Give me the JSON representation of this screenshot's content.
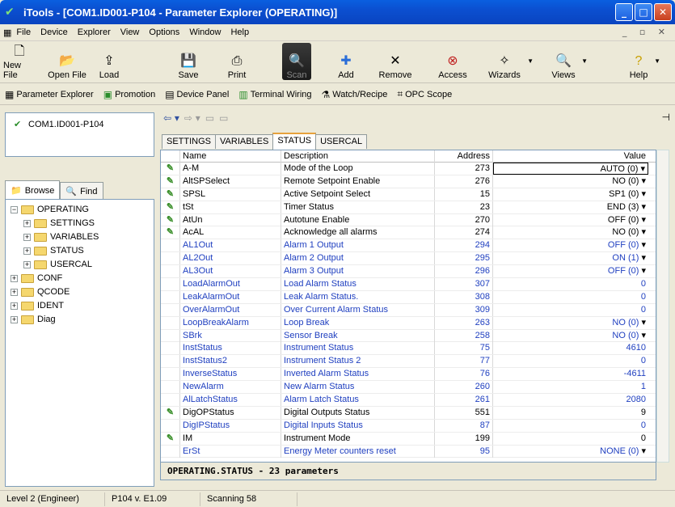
{
  "window": {
    "title": "iTools - [COM1.ID001-P104 - Parameter Explorer (OPERATING)]"
  },
  "menu": [
    "File",
    "Device",
    "Explorer",
    "View",
    "Options",
    "Window",
    "Help"
  ],
  "toolbar": [
    {
      "label": "New File",
      "icon": "new-file-icon"
    },
    {
      "label": "Open File",
      "icon": "open-file-icon"
    },
    {
      "label": "Load",
      "icon": "load-icon"
    },
    {
      "label": "Save",
      "icon": "save-icon"
    },
    {
      "label": "Print",
      "icon": "print-icon"
    },
    {
      "label": "Scan",
      "icon": "scan-icon"
    },
    {
      "label": "Add",
      "icon": "add-icon"
    },
    {
      "label": "Remove",
      "icon": "remove-icon"
    },
    {
      "label": "Access",
      "icon": "access-icon"
    },
    {
      "label": "Wizards",
      "icon": "wizards-icon"
    },
    {
      "label": "Views",
      "icon": "views-icon"
    },
    {
      "label": "Help",
      "icon": "help-icon"
    }
  ],
  "toolbar2": [
    "Parameter Explorer",
    "Promotion",
    "Device Panel",
    "Terminal Wiring",
    "Watch/Recipe",
    "OPC Scope"
  ],
  "device": "COM1.ID001-P104",
  "left_tabs": [
    "Browse",
    "Find"
  ],
  "tree": {
    "root": "OPERATING",
    "children": [
      "SETTINGS",
      "VARIABLES",
      "STATUS",
      "USERCAL"
    ],
    "others": [
      "CONF",
      "QCODE",
      "IDENT",
      "Diag"
    ]
  },
  "param_tabs": [
    "SETTINGS",
    "VARIABLES",
    "STATUS",
    "USERCAL"
  ],
  "grid": {
    "headers": [
      "Name",
      "Description",
      "Address",
      "Value"
    ],
    "rows": [
      {
        "name": "A-M",
        "desc": "Mode of the Loop",
        "addr": "273",
        "value": "AUTO (0)",
        "dd": true
      },
      {
        "name": "AltSPSelect",
        "desc": "Remote Setpoint Enable",
        "addr": "276",
        "value": "NO (0)",
        "dd": true
      },
      {
        "name": "SPSL",
        "desc": "Active Setpoint Select",
        "addr": "15",
        "value": "SP1 (0)",
        "dd": true
      },
      {
        "name": "tSt",
        "desc": "Timer Status",
        "addr": "23",
        "value": "END (3)",
        "dd": true
      },
      {
        "name": "AtUn",
        "desc": "Autotune Enable",
        "addr": "270",
        "value": "OFF (0)",
        "dd": true
      },
      {
        "name": "AcAL",
        "desc": "Acknowledge all alarms",
        "addr": "274",
        "value": "NO (0)",
        "dd": true
      },
      {
        "name": "AL1Out",
        "desc": "Alarm 1 Output",
        "addr": "294",
        "value": "OFF (0)",
        "dd": true
      },
      {
        "name": "AL2Out",
        "desc": "Alarm 2 Output",
        "addr": "295",
        "value": "ON (1)",
        "dd": true
      },
      {
        "name": "AL3Out",
        "desc": "Alarm 3 Output",
        "addr": "296",
        "value": "OFF (0)",
        "dd": true
      },
      {
        "name": "LoadAlarmOut",
        "desc": "Load Alarm Status",
        "addr": "307",
        "value": "0",
        "dd": false
      },
      {
        "name": "LeakAlarmOut",
        "desc": "Leak Alarm Status.",
        "addr": "308",
        "value": "0",
        "dd": false
      },
      {
        "name": "OverAlarmOut",
        "desc": "Over Current Alarm Status",
        "addr": "309",
        "value": "0",
        "dd": false
      },
      {
        "name": "LoopBreakAlarm",
        "desc": "Loop Break",
        "addr": "263",
        "value": "NO (0)",
        "dd": true
      },
      {
        "name": "SBrk",
        "desc": "Sensor Break",
        "addr": "258",
        "value": "NO (0)",
        "dd": true
      },
      {
        "name": "InstStatus",
        "desc": "Instrument Status",
        "addr": "75",
        "value": "4610",
        "dd": false
      },
      {
        "name": "InstStatus2",
        "desc": "Instrument Status 2",
        "addr": "77",
        "value": "0",
        "dd": false
      },
      {
        "name": "InverseStatus",
        "desc": "Inverted Alarm Status",
        "addr": "76",
        "value": "-4611",
        "dd": false
      },
      {
        "name": "NewAlarm",
        "desc": "New Alarm Status",
        "addr": "260",
        "value": "1",
        "dd": false
      },
      {
        "name": "AlLatchStatus",
        "desc": "Alarm Latch Status",
        "addr": "261",
        "value": "2080",
        "dd": false
      },
      {
        "name": "DigOPStatus",
        "desc": "Digital Outputs Status",
        "addr": "551",
        "value": "9",
        "dd": false
      },
      {
        "name": "DigIPStatus",
        "desc": "Digital Inputs Status",
        "addr": "87",
        "value": "0",
        "dd": false
      },
      {
        "name": "IM",
        "desc": "Instrument Mode",
        "addr": "199",
        "value": "0",
        "dd": false
      },
      {
        "name": "ErSt",
        "desc": "Energy Meter counters reset",
        "addr": "95",
        "value": "NONE (0)",
        "dd": true
      }
    ],
    "writable": [
      0,
      1,
      2,
      3,
      4,
      5,
      19,
      21
    ]
  },
  "footer": "OPERATING.STATUS  -  23 parameters",
  "status": [
    "Level 2 (Engineer)",
    "P104 v. E1.09",
    "Scanning 58"
  ],
  "colors": {
    "titlebar": "#0a50d8",
    "readonly_text": "#2040c0",
    "edit_pencil": "#3a8f2a"
  }
}
